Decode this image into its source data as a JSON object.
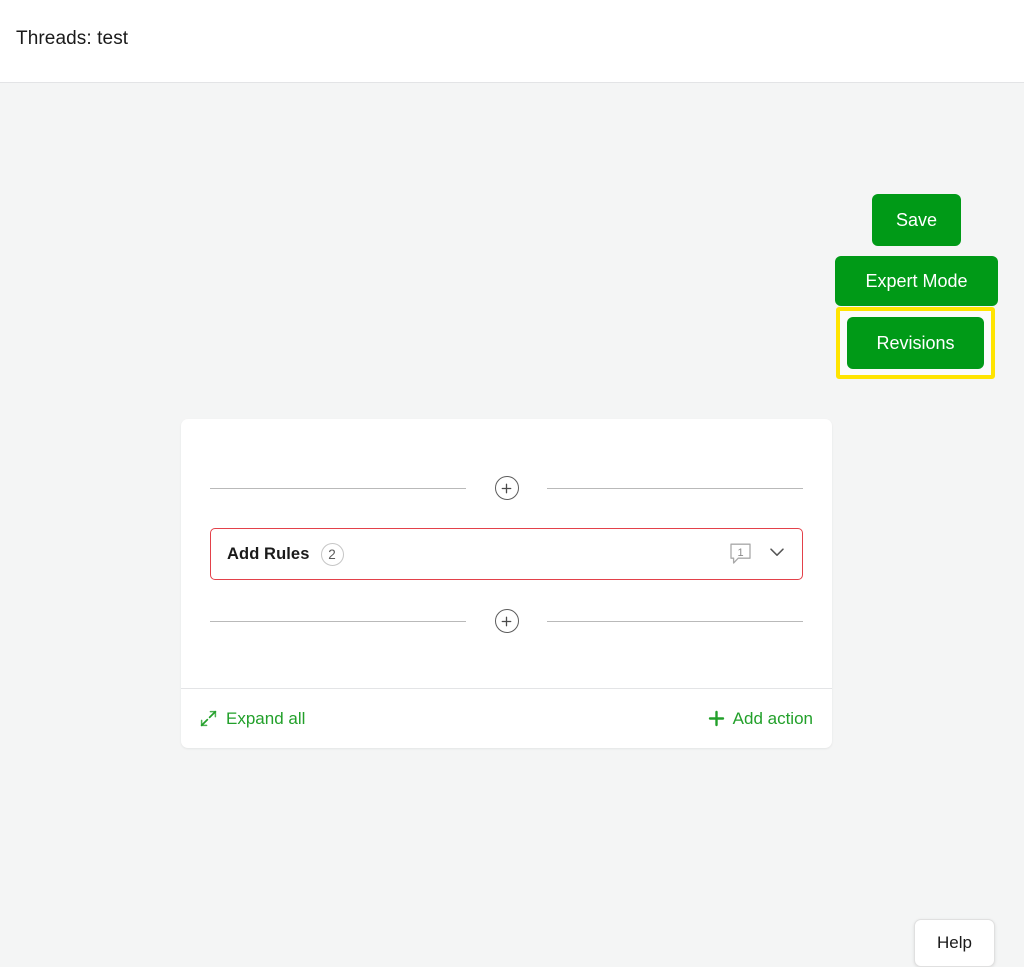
{
  "header": {
    "title": "Threads: test"
  },
  "actions": {
    "save_label": "Save",
    "expert_mode_label": "Expert Mode",
    "revisions_label": "Revisions",
    "button_color": "#009a17",
    "highlight_color": "#ffe400"
  },
  "card": {
    "add_node_top": {
      "icon": "plus-circle-icon"
    },
    "add_node_bottom": {
      "icon": "plus-circle-icon"
    },
    "rule_block": {
      "title": "Add Rules",
      "count": "2",
      "comment_count": "1",
      "comment_icon": "speech-bubble-icon",
      "expand_icon": "chevron-down-icon",
      "border_color": "#e3414a"
    },
    "footer": {
      "expand_all_label": "Expand all",
      "expand_all_icon": "expand-arrows-icon",
      "add_action_label": "Add action",
      "add_action_icon": "plus-icon",
      "link_color": "#22a02a"
    }
  },
  "help": {
    "label": "Help"
  }
}
